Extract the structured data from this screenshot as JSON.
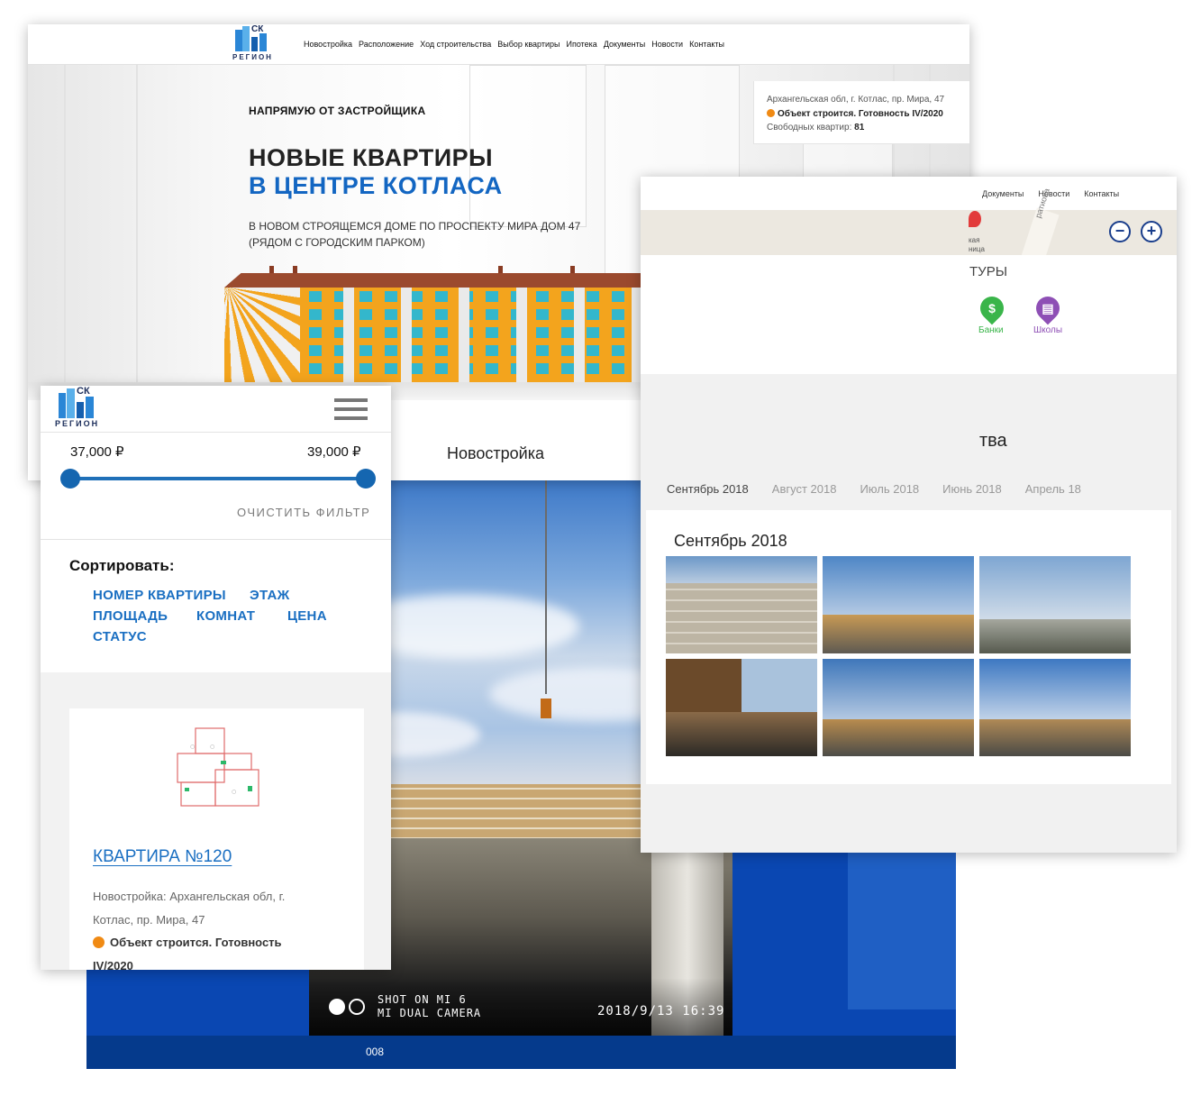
{
  "lightbox": {
    "camera_line1": "SHOT ON MI 6",
    "camera_line2": "MI DUAL CAMERA",
    "timestamp": "2018/9/13  16:39",
    "counter": "008"
  },
  "desktop": {
    "logo_ck": "СК",
    "logo_region": "РЕГИОН",
    "menu": [
      "Новостройка",
      "Расположение",
      "Ход строительства",
      "Выбор квартиры",
      "Ипотека",
      "Документы",
      "Новости",
      "Контакты"
    ],
    "tagline": "НАПРЯМУЮ ОТ ЗАСТРОЙЩИКА",
    "title_line1": "НОВЫЕ КВАРТИРЫ",
    "title_line2": "В ЦЕНТРЕ КОТЛАСА",
    "subtitle_line1": "В НОВОМ СТРОЯЩЕМСЯ ДОМЕ ПО ПРОСПЕКТУ МИРА ДОМ 47",
    "subtitle_line2": "(РЯДОМ С ГОРОДСКИМ ПАРКОМ)",
    "info": {
      "address": "Архангельская обл, г. Котлас, пр. Мира, 47",
      "status": "Объект строится. Готовность IV/2020",
      "free_label": "Свободных квартир:",
      "free_count": "81"
    },
    "section_title": "Новостройка",
    "status_color": "#f08a14",
    "accent_color": "#1366c2"
  },
  "gallery": {
    "menu": [
      "Документы",
      "Новости",
      "Контакты"
    ],
    "map_text_line1": "кая",
    "map_text_line2": "ница",
    "map_road": "ратиона",
    "zoom_out": "−",
    "zoom_in": "+",
    "infra_title_fragment": "ТУРЫ",
    "poi": [
      {
        "label": "Банки",
        "icon": "dollar-icon",
        "color": "#3ab54a"
      },
      {
        "label": "Школы",
        "icon": "book-icon",
        "color": "#8e4fb5"
      }
    ],
    "section_fragment": "тва",
    "months": [
      "Сентябрь 2018",
      "Август 2018",
      "Июль 2018",
      "Июнь 2018",
      "Апрель 18"
    ],
    "active_month": "Сентябрь 2018"
  },
  "mobile": {
    "logo_ck": "СК",
    "logo_region": "РЕГИОН",
    "price_min": "37,000 ₽",
    "price_max": "39,000 ₽",
    "range_min_fraction": 0.0,
    "range_max_fraction": 1.0,
    "clear_filter": "ОЧИСТИТЬ ФИЛЬТР",
    "sort_label": "Сортировать:",
    "sort_options": [
      "НОМЕР КВАРТИРЫ",
      "ЭТАЖ",
      "ПЛОЩАДЬ",
      "КОМНАТ",
      "ЦЕНА",
      "СТАТУС"
    ],
    "flat_name": "КВАРТИРА №120",
    "flat_addr_line1": "Новостройка: Архангельская обл, г.",
    "flat_addr_line2": "Котлас, пр. Мира, 47",
    "flat_status_line1": "Объект строится. Готовность",
    "flat_status_line2": "IV/2020"
  }
}
